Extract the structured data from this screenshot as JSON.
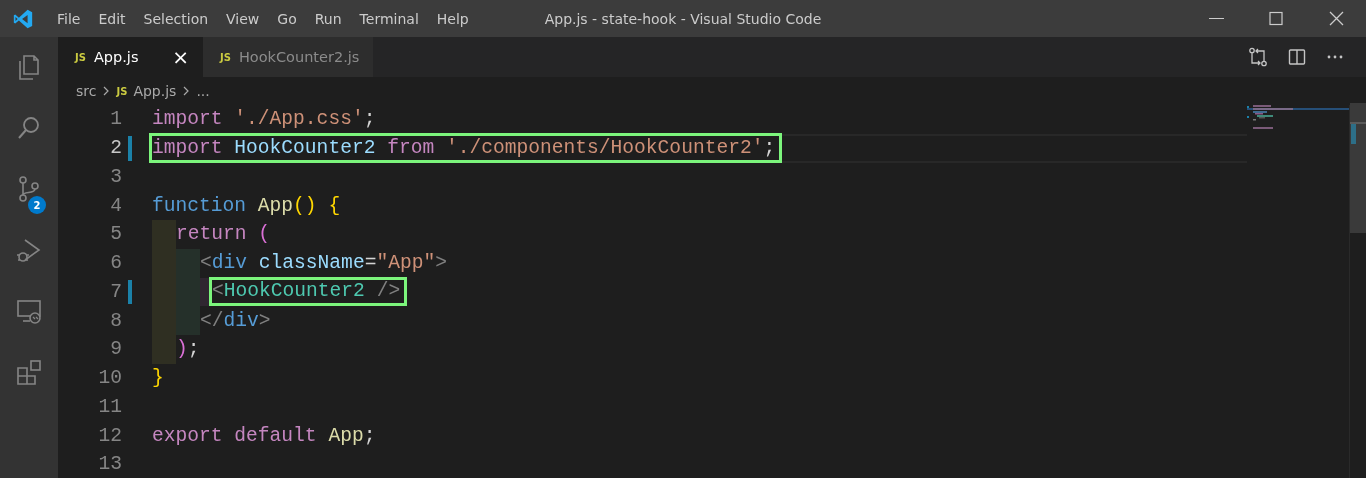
{
  "window": {
    "title": "App.js - state-hook - Visual Studio Code"
  },
  "menu": [
    "File",
    "Edit",
    "Selection",
    "View",
    "Go",
    "Run",
    "Terminal",
    "Help"
  ],
  "activity_bar": [
    {
      "kind": "files"
    },
    {
      "kind": "search"
    },
    {
      "kind": "source-control",
      "badge": "2"
    },
    {
      "kind": "debug"
    },
    {
      "kind": "remote"
    },
    {
      "kind": "extensions"
    }
  ],
  "tabs": [
    {
      "icon": "JS",
      "label": "App.js",
      "selected": true,
      "close": "×"
    },
    {
      "icon": "JS",
      "label": "HookCounter2.js",
      "selected": false
    }
  ],
  "breadcrumb": {
    "folder": "src",
    "icon": "JS",
    "file": "App.js",
    "more": "..."
  },
  "lines": [
    {
      "number": "1",
      "modified": false,
      "current": false,
      "highlighted": false,
      "tokens": [
        {
          "kind": "keyword",
          "text": "import "
        },
        {
          "kind": "string",
          "text": "'./App.css'"
        },
        {
          "kind": "punct",
          "text": ";"
        }
      ]
    },
    {
      "number": "2",
      "modified": true,
      "current": true,
      "highlighted": true,
      "tokens": [
        {
          "kind": "keyword",
          "text": "import "
        },
        {
          "kind": "variable",
          "text": "HookCounter2 "
        },
        {
          "kind": "keyword",
          "text": "from "
        },
        {
          "kind": "string",
          "text": "'./components/HookCounter2'"
        },
        {
          "kind": "punct",
          "text": ";"
        }
      ]
    },
    {
      "number": "3",
      "modified": false,
      "current": false,
      "highlighted": false
    },
    {
      "number": "4",
      "modified": false,
      "current": false,
      "highlighted": false,
      "tokens": [
        {
          "kind": "storage",
          "text": "function "
        },
        {
          "kind": "function",
          "text": "App"
        },
        {
          "kind": "bracket1",
          "text": "() {"
        }
      ]
    },
    {
      "number": "5",
      "modified": false,
      "current": false,
      "highlighted": false,
      "tokens": [
        {
          "kind": "keyword",
          "text": "  return "
        },
        {
          "kind": "bracket2",
          "text": "("
        }
      ]
    },
    {
      "number": "6",
      "modified": false,
      "current": false,
      "highlighted": false,
      "tokens": [
        {
          "kind": "tag-punct",
          "text": "    <"
        },
        {
          "kind": "tag",
          "text": "div "
        },
        {
          "kind": "attr",
          "text": "className"
        },
        {
          "kind": "punct",
          "text": "="
        },
        {
          "kind": "string",
          "text": "\"App\""
        },
        {
          "kind": "tag-punct",
          "text": ">"
        }
      ]
    },
    {
      "number": "7",
      "modified": true,
      "current": false,
      "highlighted": true,
      "tokens": [
        {
          "kind": "tag-punct",
          "text": "      <"
        },
        {
          "kind": "component",
          "text": "HookCounter2 "
        },
        {
          "kind": "tag-punct",
          "text": "/>"
        }
      ]
    },
    {
      "number": "8",
      "modified": false,
      "current": false,
      "highlighted": false,
      "tokens": [
        {
          "kind": "tag-punct",
          "text": "    </"
        },
        {
          "kind": "tag",
          "text": "div"
        },
        {
          "kind": "tag-punct",
          "text": ">"
        }
      ]
    },
    {
      "number": "9",
      "modified": false,
      "current": false,
      "highlighted": false,
      "tokens": [
        {
          "kind": "bracket2",
          "text": "  )"
        },
        {
          "kind": "punct",
          "text": ";"
        }
      ]
    },
    {
      "number": "10",
      "modified": false,
      "current": false,
      "highlighted": false,
      "tokens": [
        {
          "kind": "bracket1",
          "text": "}"
        }
      ]
    },
    {
      "number": "11",
      "modified": false,
      "current": false,
      "highlighted": false
    },
    {
      "number": "12",
      "modified": false,
      "current": false,
      "highlighted": false,
      "tokens": [
        {
          "kind": "keyword",
          "text": "export default "
        },
        {
          "kind": "function",
          "text": "App"
        },
        {
          "kind": "punct",
          "text": ";"
        }
      ]
    },
    {
      "number": "13",
      "modified": false,
      "current": false,
      "highlighted": false
    }
  ]
}
